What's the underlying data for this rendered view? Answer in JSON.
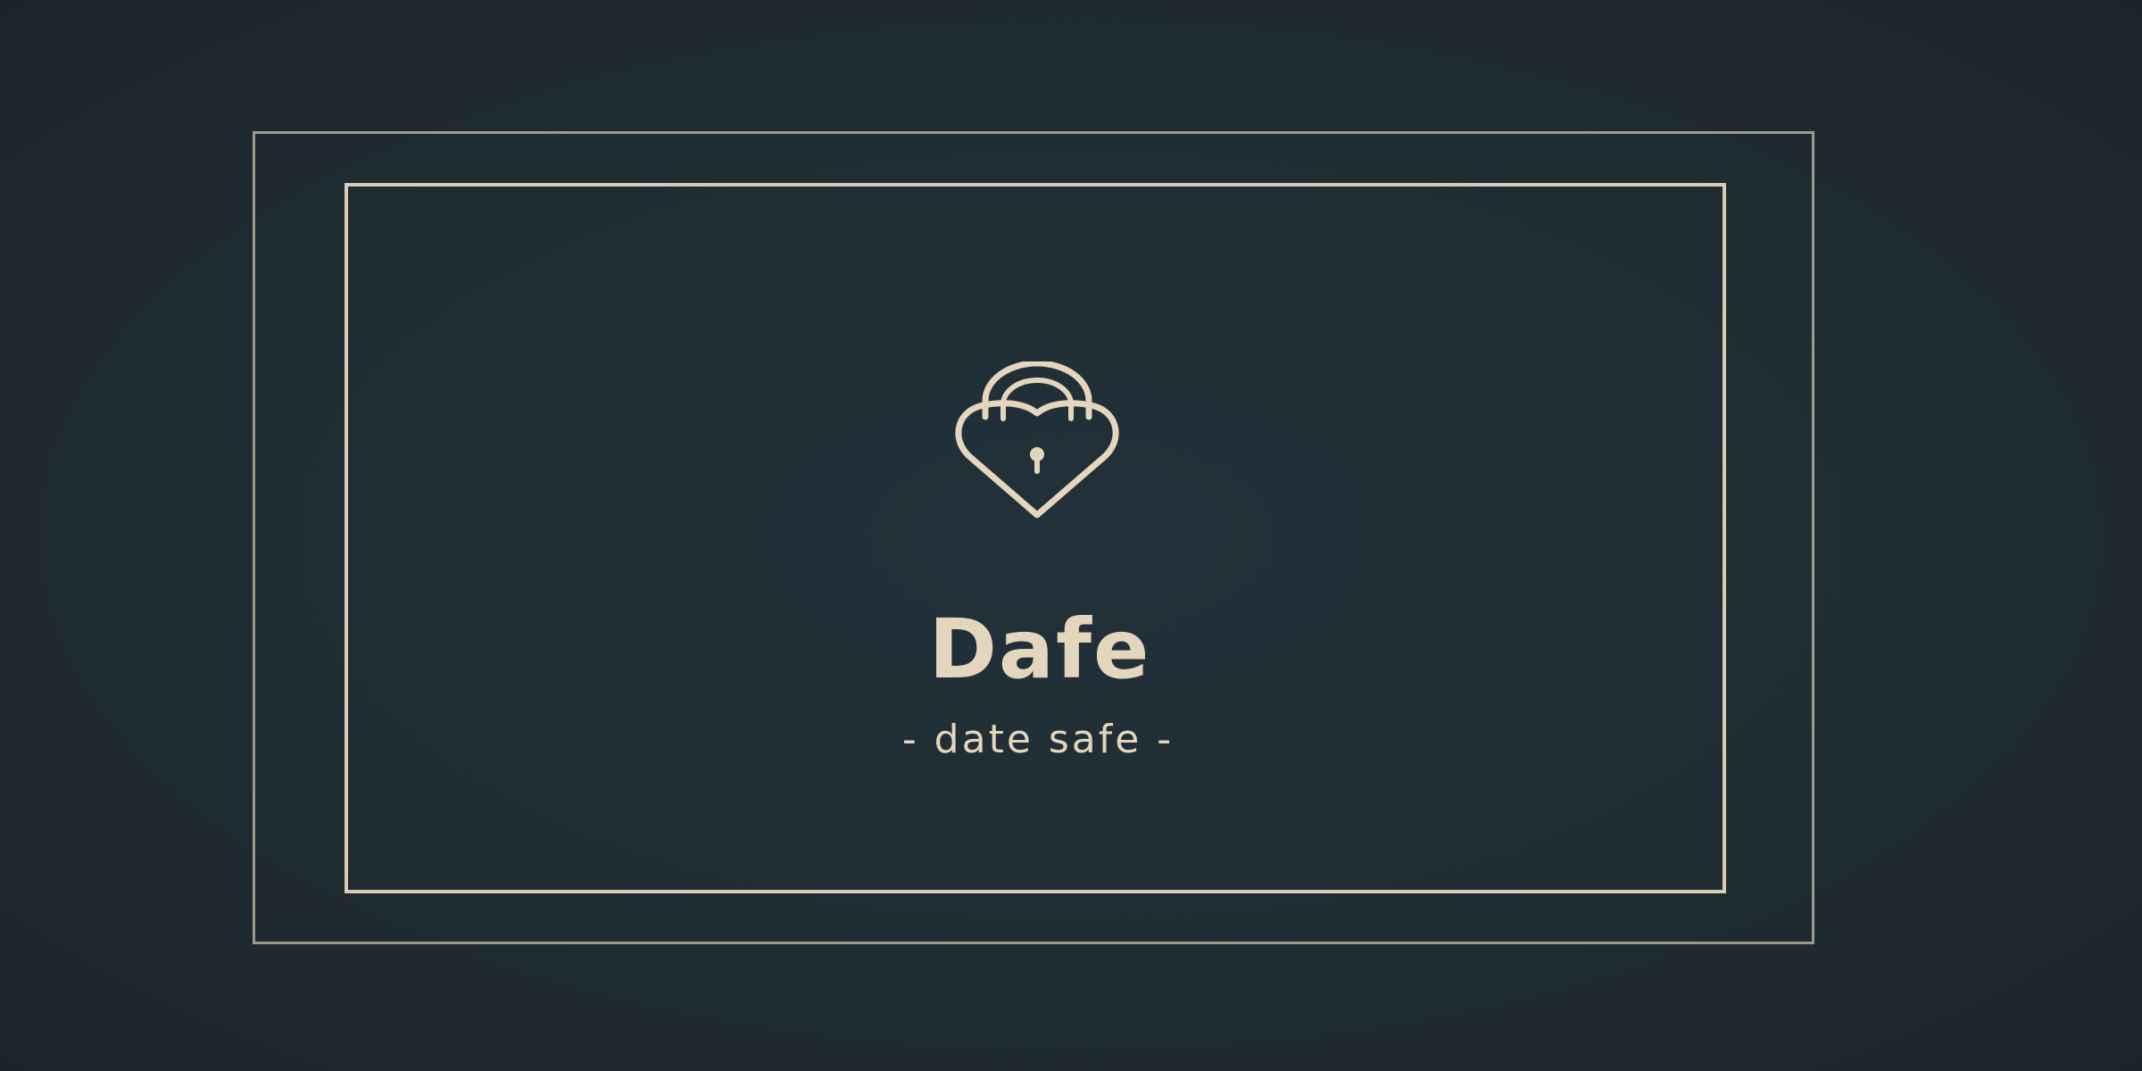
{
  "brand": {
    "name": "Dafe",
    "tagline": "- date safe -",
    "icon": "heart-padlock-icon"
  },
  "colors": {
    "background": "#1f2c32",
    "accent": "#e4d6bd",
    "outer_border": "#9f9a8e",
    "inner_border": "#d8ccb4"
  }
}
